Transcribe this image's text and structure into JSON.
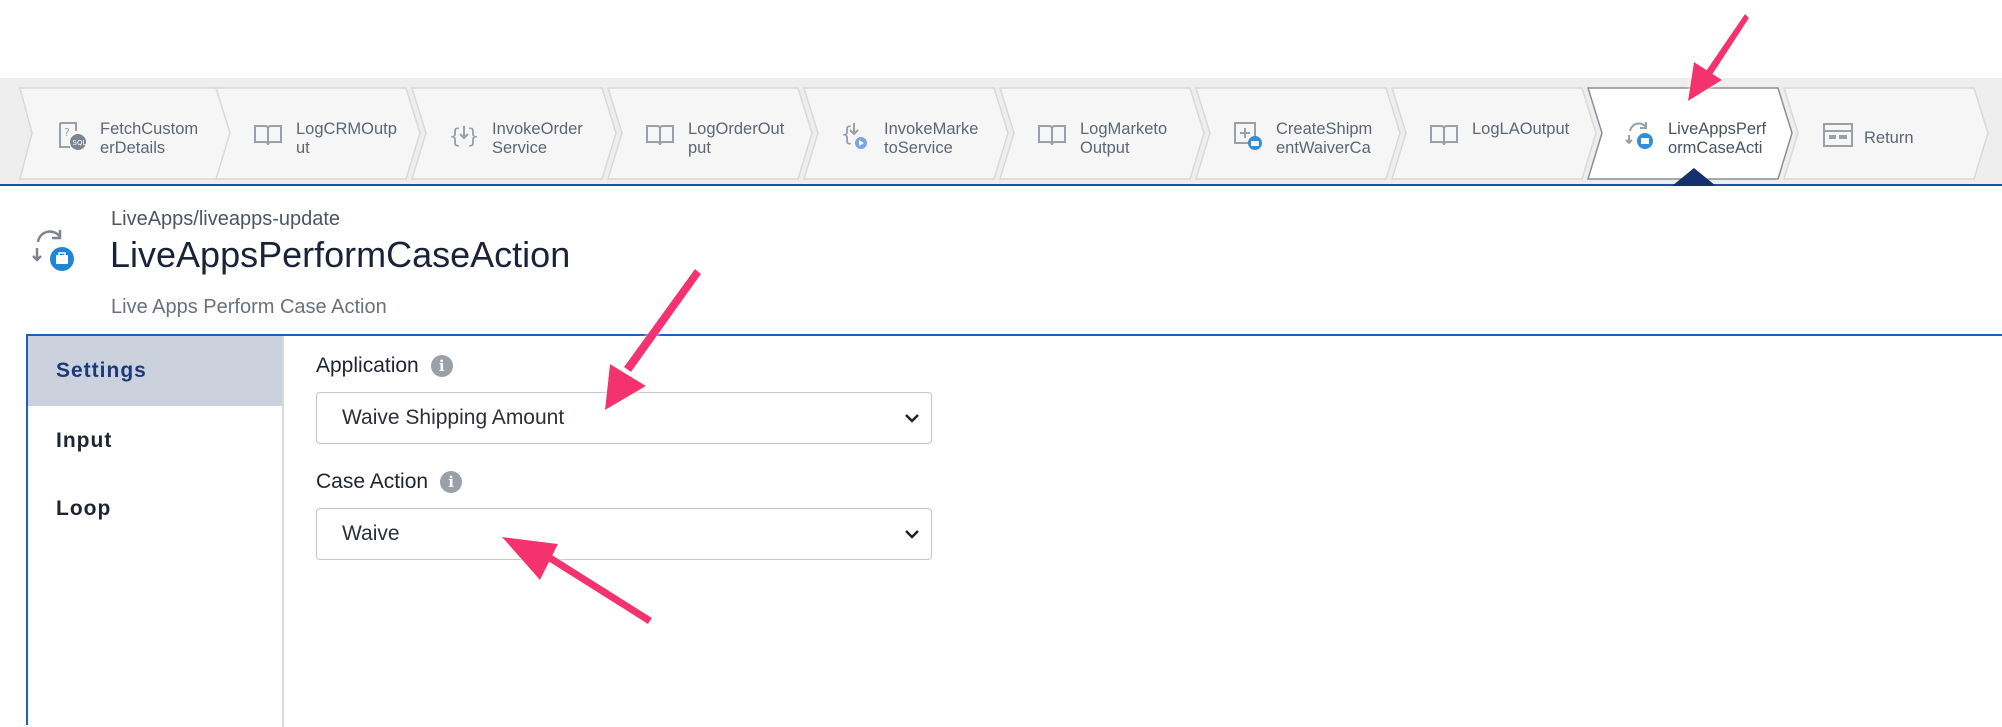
{
  "flow": {
    "steps": [
      {
        "label": "FetchCustom\nerDetails",
        "icon": "sql-query-icon"
      },
      {
        "label": "LogCRMOutp\nut",
        "icon": "book-icon"
      },
      {
        "label": "InvokeOrder\nService",
        "icon": "invoke-service-icon"
      },
      {
        "label": "LogOrderOut\nput",
        "icon": "book-icon"
      },
      {
        "label": "InvokeMarke\ntoService",
        "icon": "invoke-service-icon"
      },
      {
        "label": "LogMarketo\nOutput",
        "icon": "book-icon"
      },
      {
        "label": "CreateShipm\nentWaiverCa",
        "icon": "create-case-icon"
      },
      {
        "label": "LogLAOutput",
        "icon": "book-icon"
      },
      {
        "label": "LiveAppsPerf\normCaseActi",
        "icon": "live-apps-action-icon",
        "selected": true
      },
      {
        "label": "Return",
        "icon": "return-icon"
      }
    ]
  },
  "activity": {
    "path": "LiveApps/liveapps-update",
    "title": "LiveAppsPerformCaseAction",
    "description": "Live Apps Perform Case Action"
  },
  "tabs": {
    "settings": "Settings",
    "input": "Input",
    "loop": "Loop",
    "active": "settings"
  },
  "form": {
    "application_label": "Application",
    "application_value": "Waive Shipping Amount",
    "case_action_label": "Case Action",
    "case_action_value": "Waive"
  },
  "colors": {
    "accent": "#1f5fc0",
    "annotation_arrow": "#f5336f",
    "selected_tab_bg": "#cbd2dd"
  }
}
